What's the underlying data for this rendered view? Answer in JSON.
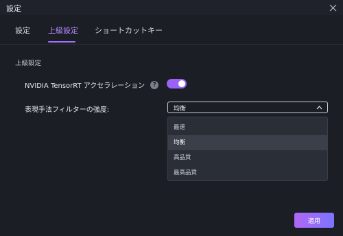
{
  "window": {
    "title": "設定"
  },
  "tabs": [
    {
      "label": "設定",
      "active": false
    },
    {
      "label": "上級設定",
      "active": true
    },
    {
      "label": "ショートカットキー",
      "active": false
    }
  ],
  "section": {
    "title": "上級設定"
  },
  "settings": {
    "acceleration": {
      "label": "NVIDIA TensorRT アクセラレーション",
      "enabled": true,
      "help_glyph": "?"
    },
    "filter_strength": {
      "label": "表現手法フィルターの強度:",
      "selected": "均衡",
      "options": [
        "最速",
        "均衡",
        "高品質",
        "最高品質"
      ]
    }
  },
  "apply_label": "適用",
  "colors": {
    "accent": "#a070ff",
    "toggle_on": "#9a63f5",
    "background": "#1b1e25",
    "dropdown_bg": "#2a2e37"
  },
  "icons": {
    "close": "close-icon",
    "help": "help-icon",
    "chevron": "chevron-up-icon"
  }
}
